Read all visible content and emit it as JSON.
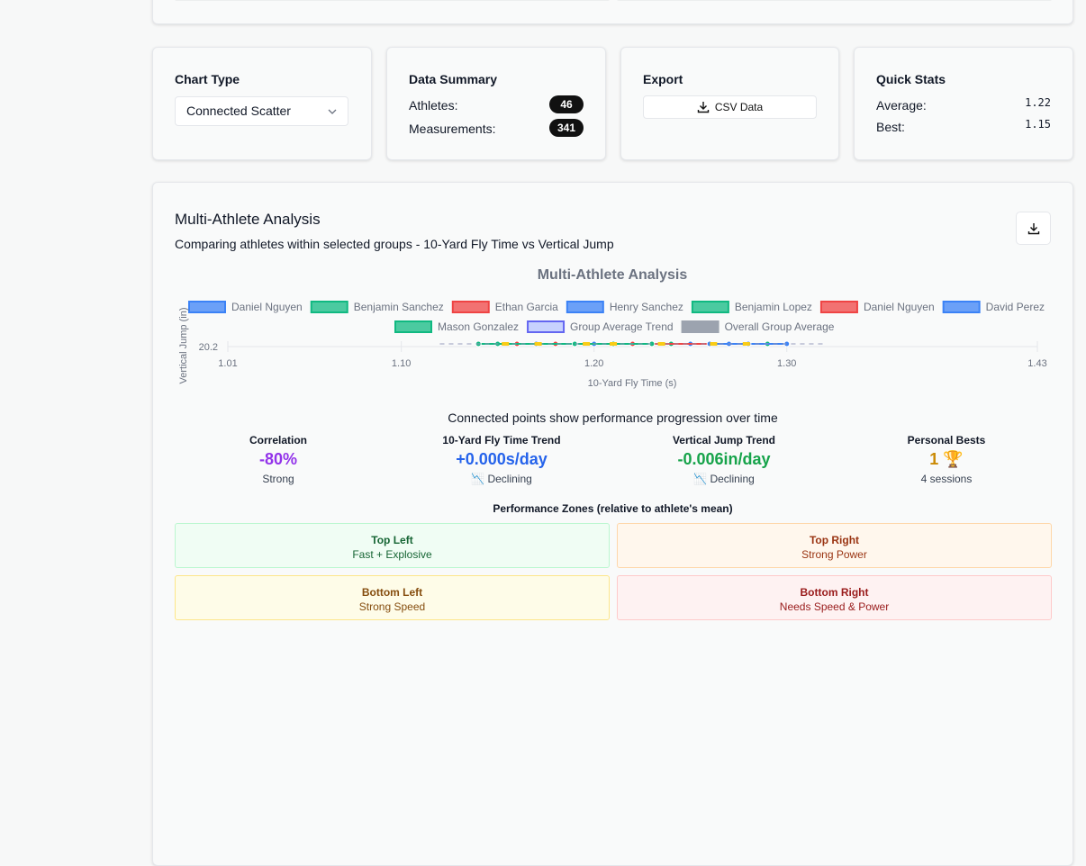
{
  "controls": {
    "chart_type": {
      "title": "Chart Type",
      "value": "Connected Scatter"
    },
    "data_summary": {
      "title": "Data Summary",
      "athletes_label": "Athletes:",
      "athletes_value": "46",
      "measurements_label": "Measurements:",
      "measurements_value": "341"
    },
    "export": {
      "title": "Export",
      "button_label": "CSV Data"
    },
    "quick_stats": {
      "title": "Quick Stats",
      "average_label": "Average:",
      "average_value": "1.22",
      "best_label": "Best:",
      "best_value": "1.15"
    }
  },
  "analysis": {
    "title": "Multi-Athlete Analysis",
    "subtitle": "Comparing athletes within selected groups - 10-Yard Fly Time vs Vertical Jump",
    "chart_caption": "Connected points show performance progression over time"
  },
  "chart_data": {
    "type": "scatter",
    "title": "Multi-Athlete Analysis",
    "xlabel": "10-Yard Fly Time (s)",
    "ylabel": "Vertical Jump (in)",
    "xlim": [
      1.01,
      1.43
    ],
    "xticks": [
      "1.01",
      "1.10",
      "1.20",
      "1.30",
      "1.43"
    ],
    "yticks": [
      "20.2"
    ],
    "grid": true,
    "legend_position": "top",
    "series": [
      {
        "name": "Daniel Nguyen",
        "color": "#3b82f6",
        "x": [
          1.17,
          1.2,
          1.24
        ],
        "y": [
          20.2,
          20.2,
          20.2
        ]
      },
      {
        "name": "Benjamin Sanchez",
        "color": "#10b981",
        "x": [
          1.15,
          1.21,
          1.26
        ],
        "y": [
          20.2,
          20.2,
          20.2
        ]
      },
      {
        "name": "Ethan Garcia",
        "color": "#ef4444",
        "x": [
          1.16,
          1.19,
          1.28
        ],
        "y": [
          20.2,
          20.2,
          20.2
        ]
      },
      {
        "name": "Henry Sanchez",
        "color": "#3b82f6",
        "x": [
          1.23,
          1.25,
          1.27
        ],
        "y": [
          20.2,
          20.2,
          20.2
        ]
      },
      {
        "name": "Benjamin Lopez",
        "color": "#10b981",
        "x": [
          1.22,
          1.24,
          1.29
        ],
        "y": [
          20.2,
          20.2,
          20.2
        ]
      },
      {
        "name": "Daniel Nguyen",
        "color": "#ef4444",
        "x": [
          1.18,
          1.22,
          1.3
        ],
        "y": [
          20.2,
          20.2,
          20.2
        ]
      },
      {
        "name": "David Perez",
        "color": "#3b82f6",
        "x": [
          1.26,
          1.28,
          1.3
        ],
        "y": [
          20.2,
          20.2,
          20.2
        ]
      },
      {
        "name": "Mason Gonzalez",
        "color": "#10b981",
        "x": [
          1.14,
          1.19,
          1.23
        ],
        "y": [
          20.2,
          20.2,
          20.2
        ]
      },
      {
        "name": "Group Average Trend",
        "color": "#6366f1",
        "x": [
          1.12,
          1.32
        ],
        "y": [
          20.2,
          20.2
        ]
      },
      {
        "name": "Overall Group Average",
        "color": "#9ca3af",
        "x": [
          1.12,
          1.32
        ],
        "y": [
          20.2,
          20.2
        ]
      }
    ]
  },
  "stats": {
    "correlation": {
      "label": "Correlation",
      "value": "-80%",
      "sub": "Strong",
      "color": "#9333ea"
    },
    "fly_trend": {
      "label": "10-Yard Fly Time Trend",
      "value": "+0.000s/day",
      "sub": "📉 Declining",
      "color": "#2563eb"
    },
    "jump_trend": {
      "label": "Vertical Jump Trend",
      "value": "-0.006in/day",
      "sub": "📉 Declining",
      "color": "#16a34a"
    },
    "personal_bests": {
      "label": "Personal Bests",
      "value": "1 🏆",
      "sub": "4 sessions",
      "color": "#ca8a04"
    }
  },
  "zones": {
    "title": "Performance Zones (relative to athlete's mean)",
    "top_left": {
      "title": "Top Left",
      "desc": "Fast + Explosive"
    },
    "top_right": {
      "title": "Top Right",
      "desc": "Strong Power"
    },
    "bottom_left": {
      "title": "Bottom Left",
      "desc": "Strong Speed"
    },
    "bottom_right": {
      "title": "Bottom Right",
      "desc": "Needs Speed & Power"
    }
  }
}
